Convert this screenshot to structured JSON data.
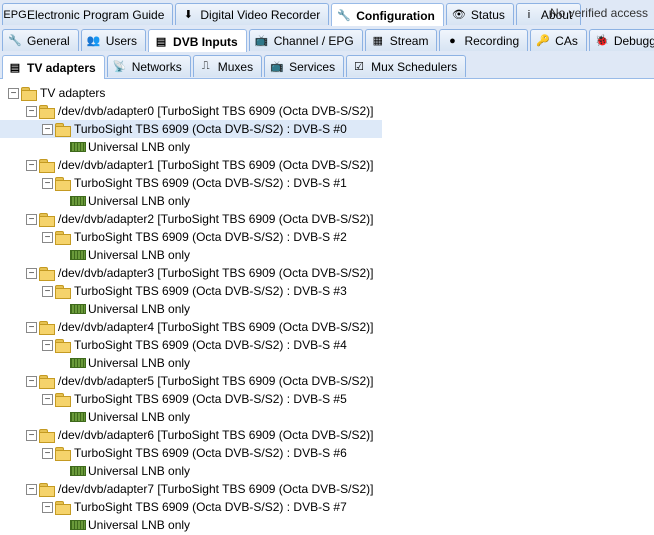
{
  "top_tabs": [
    {
      "label": "Electronic Program Guide",
      "icon": "epg-icon",
      "glyph": "EPG",
      "active": false
    },
    {
      "label": "Digital Video Recorder",
      "icon": "dvr-download-icon",
      "glyph": "⬇",
      "active": false
    },
    {
      "label": "Configuration",
      "icon": "wrench-icon",
      "glyph": "🔧",
      "active": true
    },
    {
      "label": "Status",
      "icon": "eye-icon",
      "glyph": "👁",
      "active": false
    },
    {
      "label": "About",
      "icon": "info-icon",
      "glyph": "i",
      "active": false
    }
  ],
  "status_text": "No verified access",
  "config_tabs": [
    {
      "label": "General",
      "icon": "wrench-icon",
      "glyph": "🔧",
      "active": false
    },
    {
      "label": "Users",
      "icon": "users-icon",
      "glyph": "👥",
      "active": false
    },
    {
      "label": "DVB Inputs",
      "icon": "tv-card-icon",
      "glyph": "▤",
      "active": true
    },
    {
      "label": "Channel / EPG",
      "icon": "tv-icon",
      "glyph": "📺",
      "active": false
    },
    {
      "label": "Stream",
      "icon": "stream-icon",
      "glyph": "▦",
      "active": false
    },
    {
      "label": "Recording",
      "icon": "rec-icon",
      "glyph": "●",
      "active": false
    },
    {
      "label": "CAs",
      "icon": "key-icon",
      "glyph": "🔑",
      "active": false
    },
    {
      "label": "Debugging",
      "icon": "debug-icon",
      "glyph": "🐞",
      "active": false
    }
  ],
  "dvb_tabs": [
    {
      "label": "TV adapters",
      "icon": "tv-card-icon",
      "glyph": "▤",
      "active": true
    },
    {
      "label": "Networks",
      "icon": "antenna-icon",
      "glyph": "📡",
      "active": false
    },
    {
      "label": "Muxes",
      "icon": "muxes-icon",
      "glyph": "⎍",
      "active": false
    },
    {
      "label": "Services",
      "icon": "services-icon",
      "glyph": "📺",
      "active": false
    },
    {
      "label": "Mux Schedulers",
      "icon": "scheduler-icon",
      "glyph": "☑",
      "active": false
    }
  ],
  "tree": {
    "root_label": "TV adapters",
    "adapters": [
      {
        "path": "/dev/dvb/adapter0 [TurboSight TBS 6909 (Octa DVB-S/S2)]",
        "frontend": "TurboSight TBS 6909 (Octa DVB-S/S2) : DVB-S #0",
        "lnb": "Universal LNB only",
        "selected": true
      },
      {
        "path": "/dev/dvb/adapter1 [TurboSight TBS 6909 (Octa DVB-S/S2)]",
        "frontend": "TurboSight TBS 6909 (Octa DVB-S/S2) : DVB-S #1",
        "lnb": "Universal LNB only",
        "selected": false
      },
      {
        "path": "/dev/dvb/adapter2 [TurboSight TBS 6909 (Octa DVB-S/S2)]",
        "frontend": "TurboSight TBS 6909 (Octa DVB-S/S2) : DVB-S #2",
        "lnb": "Universal LNB only",
        "selected": false
      },
      {
        "path": "/dev/dvb/adapter3 [TurboSight TBS 6909 (Octa DVB-S/S2)]",
        "frontend": "TurboSight TBS 6909 (Octa DVB-S/S2) : DVB-S #3",
        "lnb": "Universal LNB only",
        "selected": false
      },
      {
        "path": "/dev/dvb/adapter4 [TurboSight TBS 6909 (Octa DVB-S/S2)]",
        "frontend": "TurboSight TBS 6909 (Octa DVB-S/S2) : DVB-S #4",
        "lnb": "Universal LNB only",
        "selected": false
      },
      {
        "path": "/dev/dvb/adapter5 [TurboSight TBS 6909 (Octa DVB-S/S2)]",
        "frontend": "TurboSight TBS 6909 (Octa DVB-S/S2) : DVB-S #5",
        "lnb": "Universal LNB only",
        "selected": false
      },
      {
        "path": "/dev/dvb/adapter6 [TurboSight TBS 6909 (Octa DVB-S/S2)]",
        "frontend": "TurboSight TBS 6909 (Octa DVB-S/S2) : DVB-S #6",
        "lnb": "Universal LNB only",
        "selected": false
      },
      {
        "path": "/dev/dvb/adapter7 [TurboSight TBS 6909 (Octa DVB-S/S2)]",
        "frontend": "TurboSight TBS 6909 (Octa DVB-S/S2) : DVB-S #7",
        "lnb": "Universal LNB only",
        "selected": false
      }
    ]
  }
}
